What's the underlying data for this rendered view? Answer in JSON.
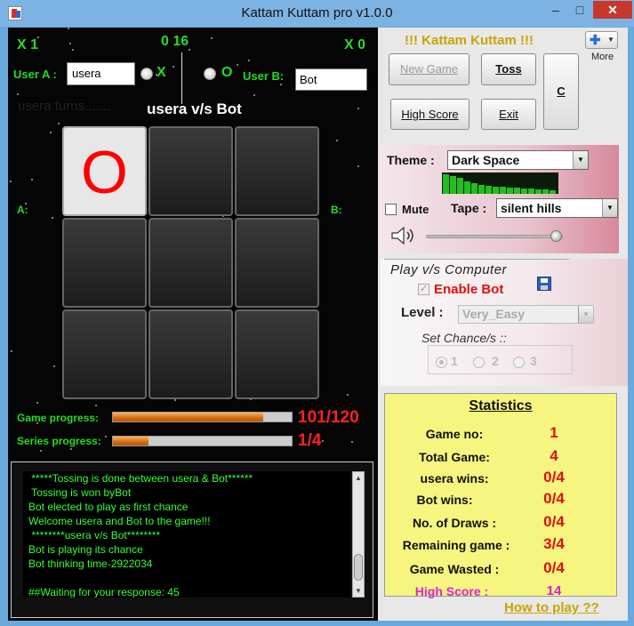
{
  "window": {
    "title": "Kattam Kuttam pro v1.0.0",
    "min": "–",
    "max": "□",
    "close": "✕"
  },
  "left": {
    "score_a": "X 1",
    "score_mid": "0 16",
    "score_b": "X 0",
    "user_a_label": "User A :",
    "user_a_value": "usera",
    "symbol_x": "X",
    "symbol_o": "O",
    "user_b_label": "User B:",
    "user_b_value": "Bot",
    "turn_text": "usera turns.......",
    "match_title": "usera v/s Bot",
    "side_a": "A:",
    "side_b": "B:",
    "board": [
      "O",
      "",
      "",
      "",
      "",
      "",
      "",
      "",
      ""
    ],
    "game_progress_label": "Game progress:",
    "game_progress_value": "101/120",
    "game_progress_fraction": 0.8417,
    "series_progress_label": "Series progress:",
    "series_progress_value": "1/4",
    "series_progress_fraction": 0.2,
    "log": [
      " *****Tossing is done between usera & Bot******",
      " Tossing is won byBot",
      "Bot elected to play as first chance",
      "Welcome usera and Bot to the game!!!",
      " ********usera v/s Bot********",
      "Bot is playing its chance",
      "Bot thinking time-2922034",
      "",
      "##Waiting for your response: 45"
    ]
  },
  "right": {
    "heading": "!!! Kattam Kuttam !!!",
    "more_label": "More",
    "buttons": {
      "new_game": "New Game",
      "toss": "Toss",
      "c": "C",
      "high_score": "High Score",
      "exit": "Exit"
    },
    "theme_label": "Theme :",
    "theme_value": "Dark Space",
    "mute_label": "Mute",
    "tape_label": "Tape :",
    "tape_value": "silent hills",
    "volume_level": 0.95,
    "play_title": "Play v/s Computer",
    "enable_bot": "Enable Bot",
    "level_label": "Level :",
    "level_value": "Very_Easy",
    "chance_label": "Set Chance/s ::",
    "chances": [
      "1",
      "2",
      "3"
    ],
    "stats": {
      "title": "Statistics",
      "rows": [
        {
          "label": "Game no:",
          "value": "1"
        },
        {
          "label": "Total Game:",
          "value": "4"
        },
        {
          "label": "usera wins:",
          "value": "0/4"
        },
        {
          "label": "Bot wins:",
          "value": "0/4"
        },
        {
          "label": "No. of Draws :",
          "value": "0/4"
        },
        {
          "label": "Remaining game :",
          "value": "3/4"
        },
        {
          "label": "Game Wasted :",
          "value": "0/4"
        },
        {
          "label": "High Score :",
          "value": "14"
        }
      ]
    },
    "how_to_play": "How to play ??"
  },
  "colors": {
    "accent_green": "#22dd22",
    "accent_red": "#e01010",
    "gold": "#c9a400",
    "stats_bg": "#f5f57f"
  }
}
